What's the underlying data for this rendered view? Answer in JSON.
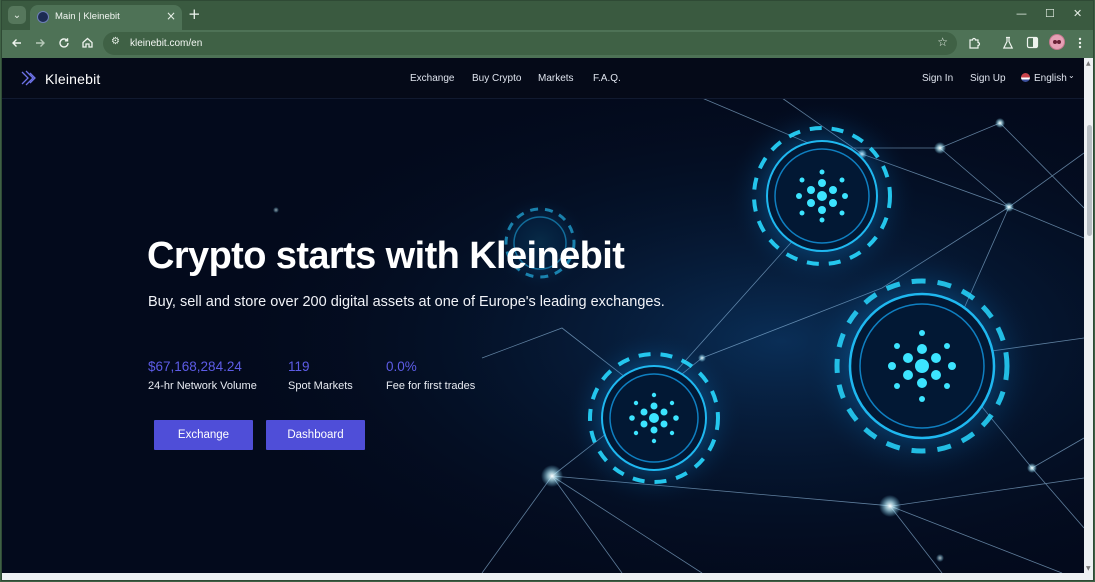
{
  "browser": {
    "tab_title": "Main | Kleinebit",
    "tab_close": "×",
    "new_tab": "+",
    "url": "kleinebit.com/en",
    "icons": {
      "tab_menu": "chevron-down-icon",
      "back": "arrow-left-icon",
      "forward": "arrow-right-icon",
      "reload": "reload-icon",
      "home": "home-icon",
      "site_info": "tune-icon",
      "bookmark": "star-icon",
      "extensions": "puzzle-icon",
      "labs": "flask-icon",
      "side_panel": "side-panel-icon",
      "profile": "avatar",
      "menu": "kebab-menu-icon"
    },
    "window_controls": {
      "minimize": "—",
      "maximize": "☐",
      "close": "✕"
    }
  },
  "site": {
    "brand": "Kleinebit",
    "nav": [
      {
        "label": "Exchange"
      },
      {
        "label": "Buy Crypto"
      },
      {
        "label": "Markets"
      },
      {
        "label": "F.A.Q."
      }
    ],
    "auth": {
      "sign_in": "Sign In",
      "sign_up": "Sign Up"
    },
    "language": "English"
  },
  "hero": {
    "title": "Crypto starts with Kleinebit",
    "subtitle": "Buy, sell and store over 200 digital assets at one of Europe's leading exchanges.",
    "stats": [
      {
        "value": "$67,168,284.24",
        "label": "24-hr Network Volume"
      },
      {
        "value": "119",
        "label": "Spot Markets"
      },
      {
        "value": "0.0%",
        "label": "Fee for first trades"
      }
    ],
    "buttons": {
      "exchange": "Exchange",
      "dashboard": "Dashboard"
    }
  },
  "colors": {
    "browser_frame": "#3a5a40",
    "page_background": "#030a1c",
    "accent": "#4f4ed8",
    "stat_value": "#5d5ce6",
    "glow": "#22d3ee"
  }
}
